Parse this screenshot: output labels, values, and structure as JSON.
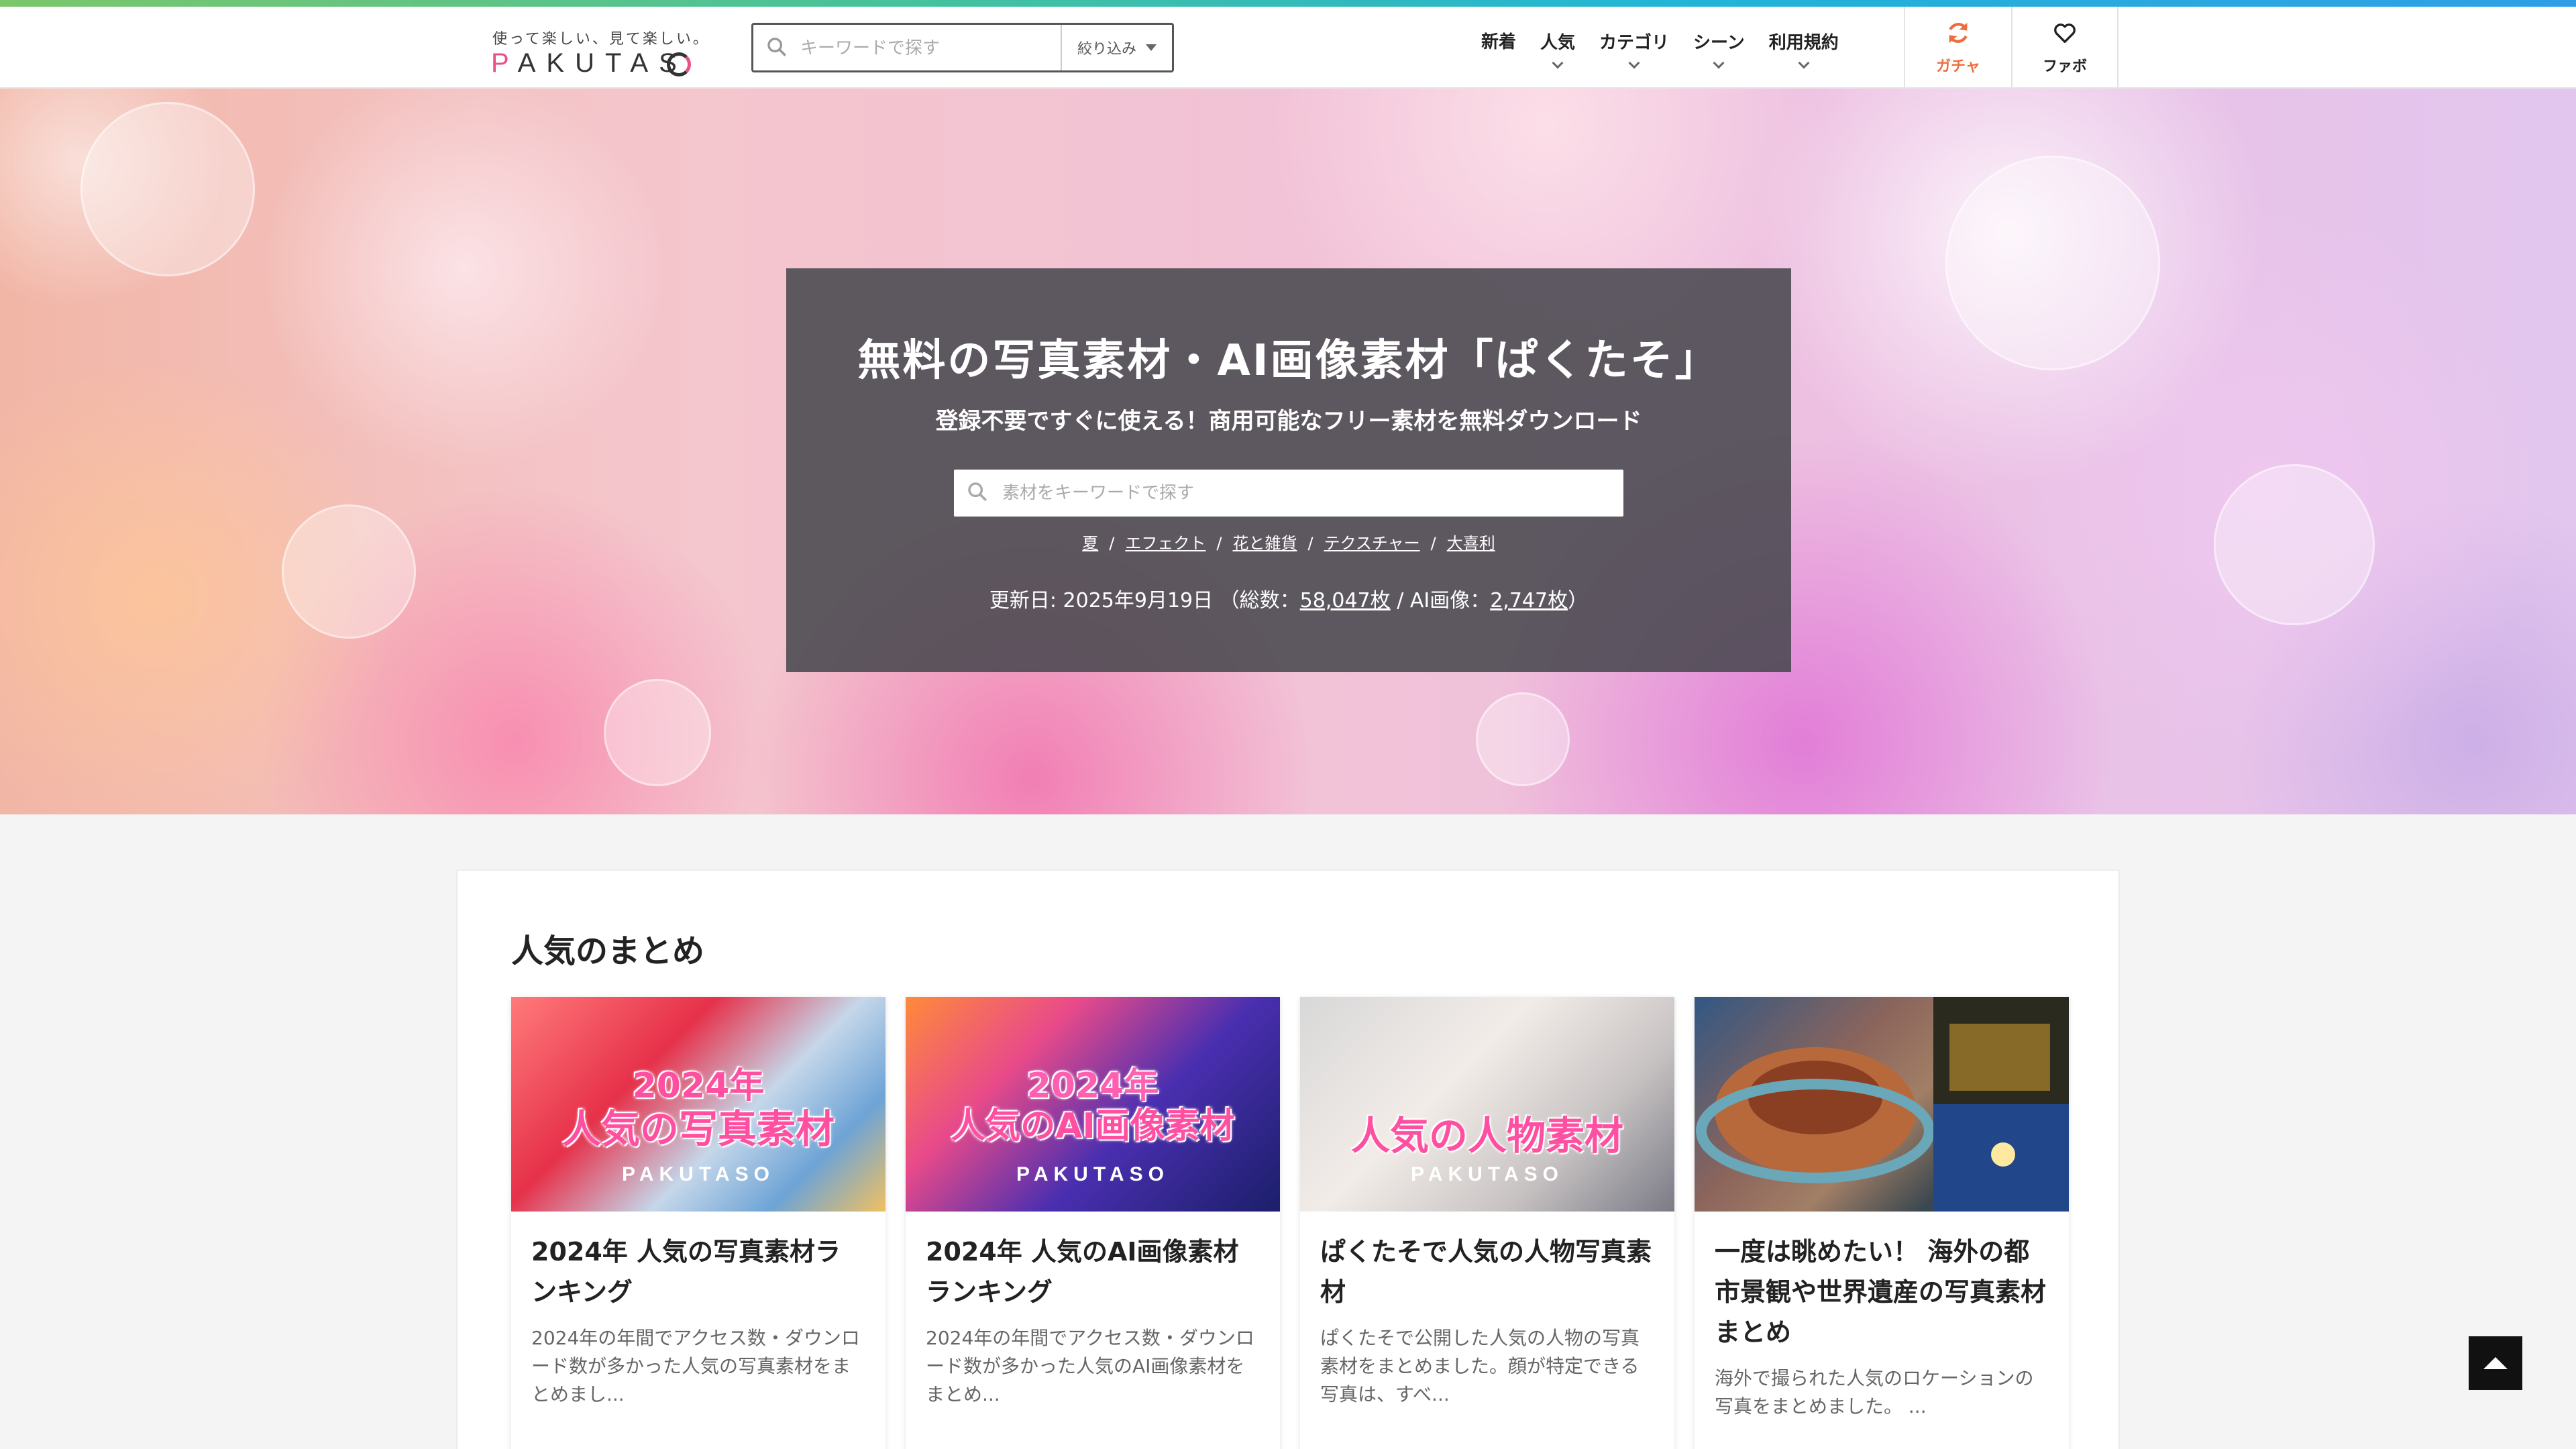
{
  "header": {
    "tagline": "使って楽しい、見て楽しい。",
    "logo_text": "PAKUTASO",
    "search_placeholder": "キーワードで探す",
    "filter_label": "絞り込み",
    "nav": [
      {
        "label": "新着"
      },
      {
        "label": "人気"
      },
      {
        "label": "カテゴリ"
      },
      {
        "label": "シーン"
      },
      {
        "label": "利用規約"
      }
    ],
    "gacha_label": "ガチャ",
    "fav_label": "ファボ"
  },
  "hero": {
    "title": "無料の写真素材・AI画像素材「ぱくたそ」",
    "subtitle": "登録不要ですぐに使える！商用可能なフリー素材を無料ダウンロード",
    "search_placeholder": "素材をキーワードで探す",
    "tags": [
      "夏",
      "エフェクト",
      "花と雑貨",
      "テクスチャー",
      "大喜利"
    ],
    "updated_prefix": "更新日: 2025年9月19日 （総数：",
    "total": "58,047枚",
    "ai_prefix": " / AI画像：",
    "ai_total": "2,747枚",
    "updated_suffix": "）"
  },
  "popular": {
    "title": "人気のまとめ",
    "cards": [
      {
        "thumb_year": "2024年",
        "thumb_main": "人気の写真素材",
        "thumb_logo": "PAKUTASO",
        "title": "2024年 人気の写真素材ランキング",
        "desc": "2024年の年間でアクセス数・ダウンロード数が多かった人気の写真素材をまとめまし..."
      },
      {
        "thumb_year": "2024年",
        "thumb_main": "人気のAI画像素材",
        "thumb_logo": "PAKUTASO",
        "title": "2024年 人気のAI画像素材ランキング",
        "desc": "2024年の年間でアクセス数・ダウンロード数が多かった人気のAI画像素材をまとめ..."
      },
      {
        "thumb_year": "",
        "thumb_main": "人気の人物素材",
        "thumb_logo": "PAKUTASO",
        "title": "ぱくたそで人気の人物写真素材",
        "desc": "ぱくたそで公開した人気の人物の写真素材をまとめました。顔が特定できる写真は、すべ..."
      },
      {
        "thumb_year": "",
        "thumb_main": "",
        "thumb_logo": "",
        "title": "一度は眺めたい！ 海外の都市景観や世界遺産の写真素材まとめ",
        "desc": "海外で撮られた人気のロケーションの写真をまとめました。 ..."
      }
    ]
  },
  "colors": {
    "accent_pink": "#e8508a",
    "gacha_orange": "#ef6c3c",
    "hero_panel": "#48484e"
  },
  "icons": {
    "search": "search-icon",
    "gacha": "refresh-icon",
    "fav": "heart-icon",
    "to_top": "arrow-up-icon"
  }
}
